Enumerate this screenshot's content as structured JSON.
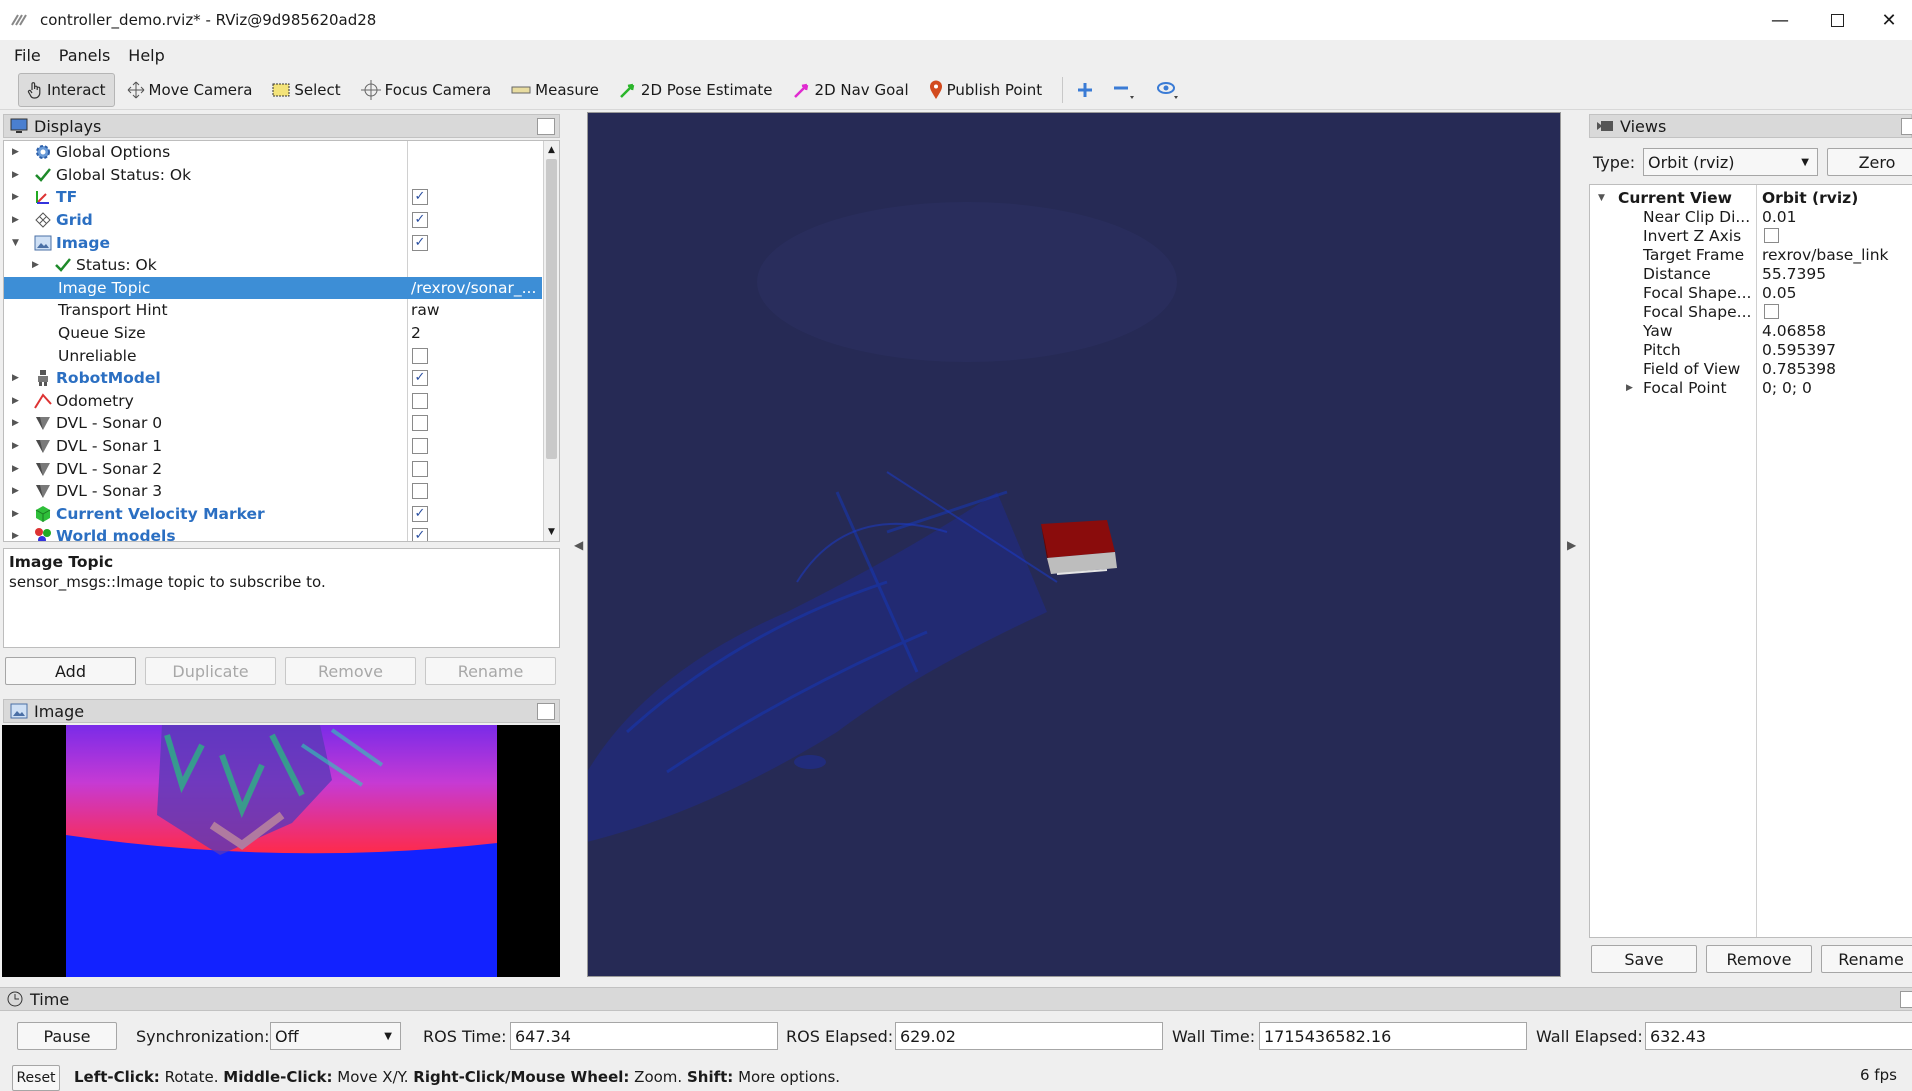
{
  "window": {
    "title": "controller_demo.rviz* - RViz@9d985620ad28"
  },
  "menu": {
    "items": [
      "File",
      "Panels",
      "Help"
    ]
  },
  "toolbar": {
    "interact": "Interact",
    "move_camera": "Move Camera",
    "select": "Select",
    "focus_camera": "Focus Camera",
    "measure": "Measure",
    "pose_estimate": "2D Pose Estimate",
    "nav_goal": "2D Nav Goal",
    "publish_point": "Publish Point"
  },
  "displays": {
    "title": "Displays",
    "rows": [
      {
        "label": "Global Options",
        "value": ""
      },
      {
        "label": "Global Status: Ok",
        "value": ""
      },
      {
        "label": "TF",
        "value": ""
      },
      {
        "label": "Grid",
        "value": ""
      },
      {
        "label": "Image",
        "value": ""
      },
      {
        "label": "Status: Ok",
        "value": ""
      },
      {
        "label": "Image Topic",
        "value": "/rexrov/sonar_..."
      },
      {
        "label": "Transport Hint",
        "value": "raw"
      },
      {
        "label": "Queue Size",
        "value": "2"
      },
      {
        "label": "Unreliable",
        "value": ""
      },
      {
        "label": "RobotModel",
        "value": ""
      },
      {
        "label": "Odometry",
        "value": ""
      },
      {
        "label": "DVL - Sonar 0",
        "value": ""
      },
      {
        "label": "DVL - Sonar 1",
        "value": ""
      },
      {
        "label": "DVL - Sonar 2",
        "value": ""
      },
      {
        "label": "DVL - Sonar 3",
        "value": ""
      },
      {
        "label": "Current Velocity Marker",
        "value": ""
      },
      {
        "label": "World models",
        "value": ""
      }
    ],
    "checks": {
      "TF": true,
      "Grid": true,
      "Image": true,
      "Unreliable": false,
      "RobotModel": true,
      "Odometry": false,
      "DVL - Sonar 0": false,
      "DVL - Sonar 1": false,
      "DVL - Sonar 2": false,
      "DVL - Sonar 3": false,
      "Current Velocity Marker": true,
      "World models": true
    },
    "description_title": "Image Topic",
    "description_text": "sensor_msgs::Image topic to subscribe to.",
    "buttons": {
      "add": "Add",
      "duplicate": "Duplicate",
      "remove": "Remove",
      "rename": "Rename"
    }
  },
  "image_panel": {
    "title": "Image"
  },
  "views": {
    "title": "Views",
    "type_label": "Type:",
    "type_value": "Orbit (rviz)",
    "zero": "Zero",
    "header": {
      "label": "Current View",
      "value": "Orbit (rviz)"
    },
    "rows": [
      {
        "label": "Near Clip Di...",
        "value": "0.01"
      },
      {
        "label": "Invert Z Axis",
        "value": ""
      },
      {
        "label": "Target Frame",
        "value": "rexrov/base_link"
      },
      {
        "label": "Distance",
        "value": "55.7395"
      },
      {
        "label": "Focal Shape...",
        "value": "0.05"
      },
      {
        "label": "Focal Shape...",
        "value": ""
      },
      {
        "label": "Yaw",
        "value": "4.06858"
      },
      {
        "label": "Pitch",
        "value": "0.595397"
      },
      {
        "label": "Field of View",
        "value": "0.785398"
      },
      {
        "label": "Focal Point",
        "value": "0; 0; 0"
      }
    ],
    "buttons": {
      "save": "Save",
      "remove": "Remove",
      "rename": "Rename"
    }
  },
  "time": {
    "title": "Time",
    "pause": "Pause",
    "sync_label": "Synchronization:",
    "sync_value": "Off",
    "ros_time_label": "ROS Time:",
    "ros_time": "647.34",
    "ros_elapsed_label": "ROS Elapsed:",
    "ros_elapsed": "629.02",
    "wall_time_label": "Wall Time:",
    "wall_time": "1715436582.16",
    "wall_elapsed_label": "Wall Elapsed:",
    "wall_elapsed": "632.43"
  },
  "statusbar": {
    "reset": "Reset",
    "help_lc_key": "Left-Click:",
    "help_lc": "Rotate.",
    "help_mc_key": "Middle-Click:",
    "help_mc": "Move X/Y.",
    "help_rc_key": "Right-Click/Mouse Wheel:",
    "help_rc": "Zoom.",
    "help_shift_key": "Shift:",
    "help_shift": "More options.",
    "fps": "6 fps"
  },
  "colors": {
    "viewport_bg": "#262a55",
    "selection": "#3d8ed6",
    "link_blue": "#2b6fc2"
  }
}
